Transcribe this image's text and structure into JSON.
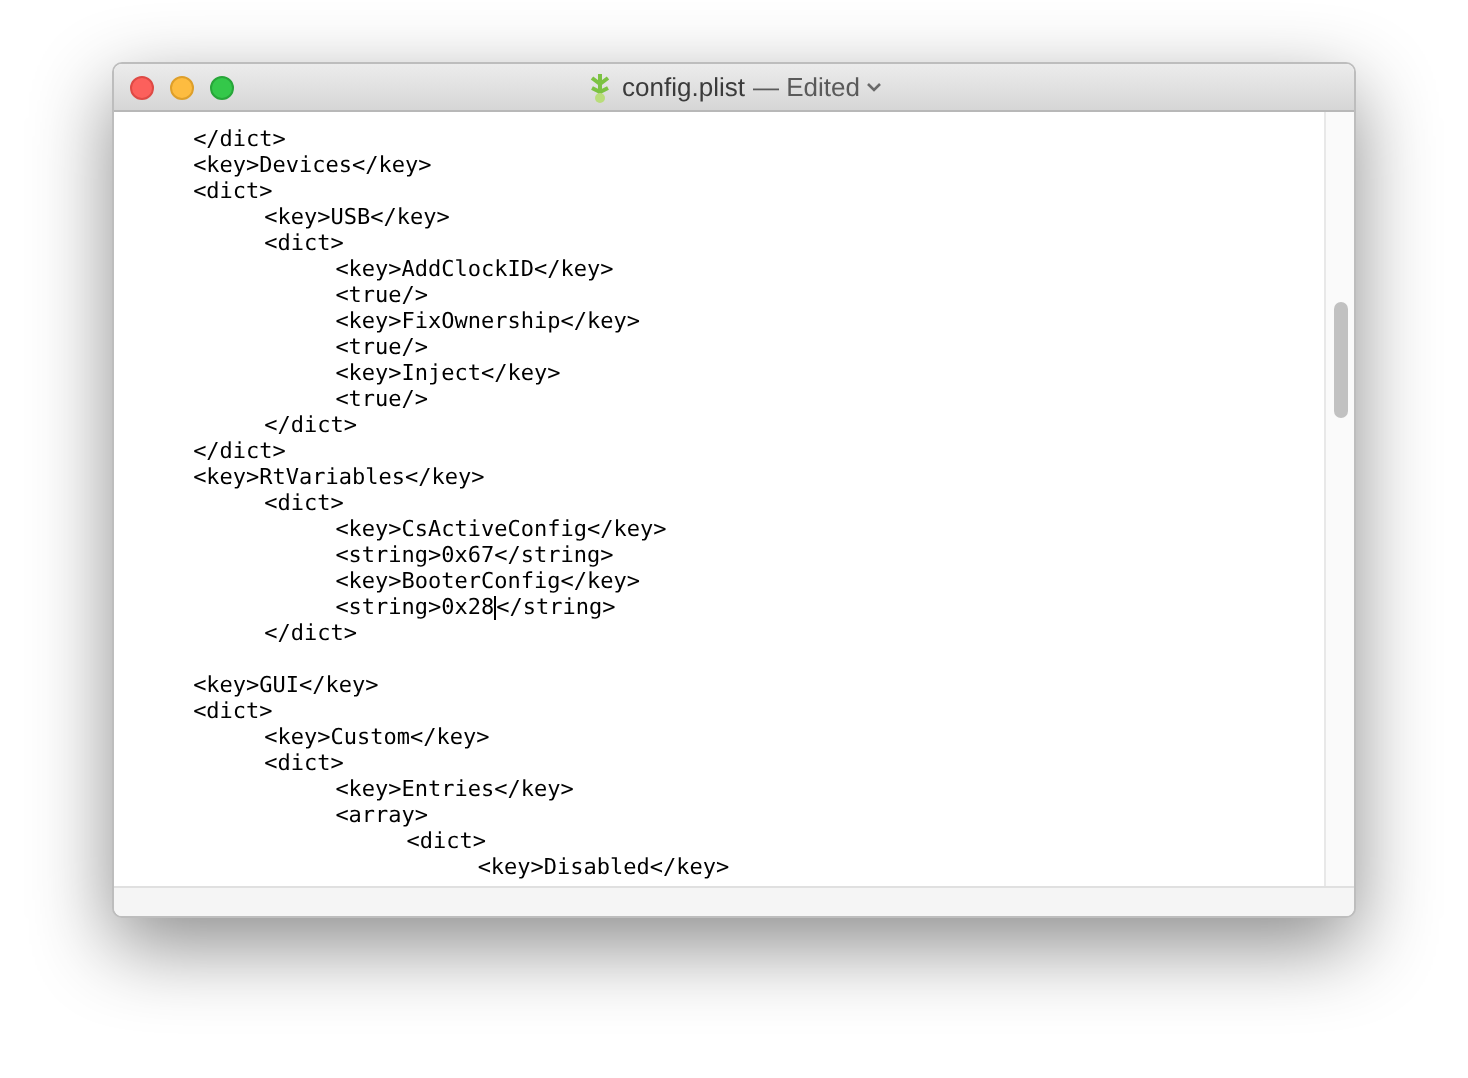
{
  "window": {
    "title": "config.plist",
    "status": "— Edited"
  },
  "lines": [
    {
      "kind": "code",
      "text": "\t</dict>"
    },
    {
      "kind": "code",
      "text": "\t<key>Devices</key>"
    },
    {
      "kind": "code",
      "text": "\t<dict>"
    },
    {
      "kind": "code",
      "text": "\t\t<key>USB</key>"
    },
    {
      "kind": "code",
      "text": "\t\t<dict>"
    },
    {
      "kind": "code",
      "text": "\t\t\t<key>AddClockID</key>"
    },
    {
      "kind": "code",
      "text": "\t\t\t<true/>"
    },
    {
      "kind": "code",
      "text": "\t\t\t<key>FixOwnership</key>"
    },
    {
      "kind": "code",
      "text": "\t\t\t<true/>"
    },
    {
      "kind": "code",
      "text": "\t\t\t<key>Inject</key>"
    },
    {
      "kind": "code",
      "text": "\t\t\t<true/>"
    },
    {
      "kind": "code",
      "text": "\t\t</dict>"
    },
    {
      "kind": "code",
      "text": "\t</dict>"
    },
    {
      "kind": "code",
      "text": "\t<key>RtVariables</key>"
    },
    {
      "kind": "code",
      "text": "\t\t<dict>"
    },
    {
      "kind": "code",
      "text": "\t\t\t<key>CsActiveConfig</key>"
    },
    {
      "kind": "code",
      "text": "\t\t\t<string>0x67</string>"
    },
    {
      "kind": "code",
      "text": "\t\t\t<key>BooterConfig</key>"
    },
    {
      "kind": "code",
      "text": "\t\t\t<string>0x28",
      "after_caret": "</string>",
      "caret": true
    },
    {
      "kind": "code",
      "text": "\t\t</dict>"
    },
    {
      "kind": "blank"
    },
    {
      "kind": "code",
      "text": "\t<key>GUI</key>"
    },
    {
      "kind": "code",
      "text": "\t<dict>"
    },
    {
      "kind": "code",
      "text": "\t\t<key>Custom</key>"
    },
    {
      "kind": "code",
      "text": "\t\t<dict>"
    },
    {
      "kind": "code",
      "text": "\t\t\t<key>Entries</key>"
    },
    {
      "kind": "code",
      "text": "\t\t\t<array>"
    },
    {
      "kind": "code",
      "text": "\t\t\t\t<dict>"
    },
    {
      "kind": "code",
      "text": "\t\t\t\t\t<key>Disabled</key>"
    }
  ]
}
